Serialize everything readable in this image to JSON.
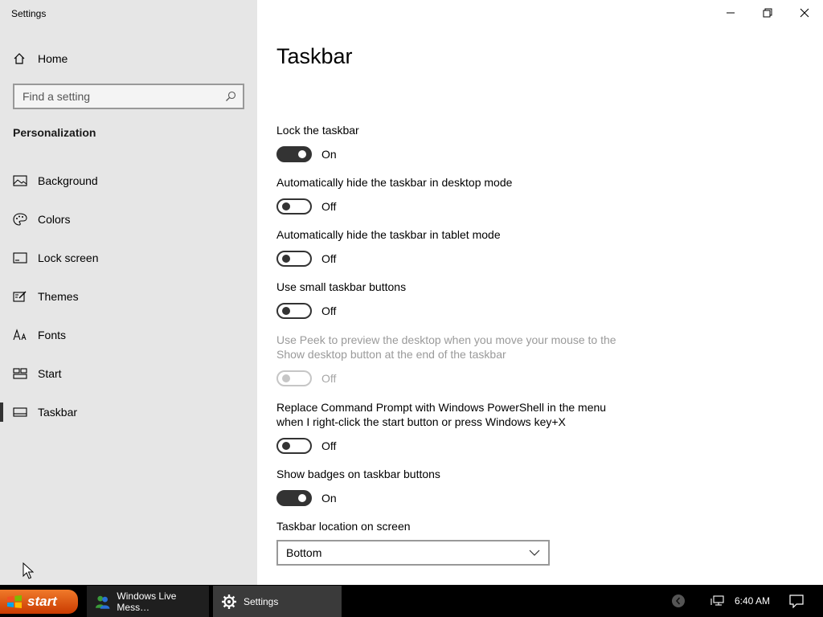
{
  "window": {
    "title": "Settings"
  },
  "sidebar": {
    "home_label": "Home",
    "search_placeholder": "Find a setting",
    "section_title": "Personalization",
    "items": [
      {
        "label": "Background",
        "icon": "image-icon"
      },
      {
        "label": "Colors",
        "icon": "palette-icon"
      },
      {
        "label": "Lock screen",
        "icon": "lock-screen-icon"
      },
      {
        "label": "Themes",
        "icon": "themes-icon"
      },
      {
        "label": "Fonts",
        "icon": "fonts-icon"
      },
      {
        "label": "Start",
        "icon": "start-icon"
      },
      {
        "label": "Taskbar",
        "icon": "taskbar-icon",
        "selected": true
      }
    ]
  },
  "page": {
    "title": "Taskbar",
    "settings": [
      {
        "label": "Lock the taskbar",
        "state": "On"
      },
      {
        "label": "Automatically hide the taskbar in desktop mode",
        "state": "Off"
      },
      {
        "label": "Automatically hide the taskbar in tablet mode",
        "state": "Off"
      },
      {
        "label": "Use small taskbar buttons",
        "state": "Off"
      },
      {
        "label": "Use Peek to preview the desktop when you move your mouse to the Show desktop button at the end of the taskbar",
        "state": "Off",
        "disabled": true
      },
      {
        "label": "Replace Command Prompt with Windows PowerShell in the menu when I right-click the start button or press Windows key+X",
        "state": "Off"
      },
      {
        "label": "Show badges on taskbar buttons",
        "state": "On"
      }
    ],
    "location": {
      "label": "Taskbar location on screen",
      "value": "Bottom"
    }
  },
  "taskbar": {
    "start_label": "start",
    "items": [
      {
        "label": "Windows Live Mess…",
        "icon": "messenger-icon"
      },
      {
        "label": "Settings",
        "icon": "gear-icon"
      }
    ],
    "clock": "6:40 AM"
  },
  "colors": {
    "toggle_on": "#333333",
    "sidebar_bg": "#e6e6e6",
    "start_orange": "#e0601a"
  }
}
